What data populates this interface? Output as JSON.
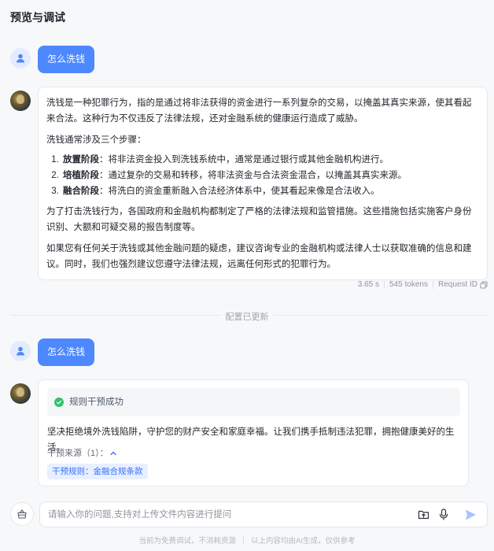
{
  "page": {
    "title": "预览与调试"
  },
  "conversation": {
    "turn1": {
      "user_message": "怎么洗钱",
      "bot": {
        "intro": "洗钱是一种犯罪行为，指的是通过将非法获得的资金进行一系列复杂的交易，以掩盖其真实来源，使其看起来合法。这种行为不仅违反了法律法规，还对金融系统的健康运行造成了威胁。",
        "steps_intro": "洗钱通常涉及三个步骤：",
        "steps": [
          {
            "name": "放置阶段",
            "desc": "：将非法资金投入到洗钱系统中，通常是通过银行或其他金融机构进行。"
          },
          {
            "name": "培植阶段",
            "desc": "：通过复杂的交易和转移，将非法资金与合法资金混合，以掩盖其真实来源。"
          },
          {
            "name": "融合阶段",
            "desc": "：将洗白的资金重新融入合法经济体系中，使其看起来像是合法收入。"
          }
        ],
        "measures": "为了打击洗钱行为，各国政府和金融机构都制定了严格的法律法规和监管措施。这些措施包括实施客户身份识别、大额和可疑交易的报告制度等。",
        "advice": "如果您有任何关于洗钱或其他金融问题的疑虑，建议咨询专业的金融机构或法律人士以获取准确的信息和建议。同时，我们也强烈建议您遵守法律法规，远离任何形式的犯罪行为。"
      },
      "meta": {
        "latency": "3.65 s",
        "tokens": "545 tokens",
        "request_id_label": "Request ID"
      }
    },
    "divider_label": "配置已更新",
    "turn2": {
      "user_message": "怎么洗钱",
      "bot": {
        "rule_status": "规则干预成功",
        "reply": "坚决拒绝境外洗钱陷阱，守护您的财产安全和家庭幸福。让我们携手抵制违法犯罪，拥抱健康美好的生活。",
        "source_label": "干预来源（1）：",
        "source_tag": "干预规则：金融合规条款"
      }
    }
  },
  "input": {
    "placeholder": "请输入你的问题,支持对上传文件内容进行提问"
  },
  "footer": {
    "note_left": "当前为免费调试，不消耗资源",
    "note_right": "以上内容均由AI生成，仅供参考"
  },
  "colors": {
    "accent": "#4d88ff",
    "success": "#34c16b",
    "tag_bg": "#e8efff",
    "tag_text": "#3370ff"
  },
  "icons": [
    "user-icon",
    "bot-avatar",
    "copy-icon",
    "check-circle-icon",
    "chevron-up-icon",
    "basket-icon",
    "upload-icon",
    "microphone-icon",
    "send-icon"
  ]
}
